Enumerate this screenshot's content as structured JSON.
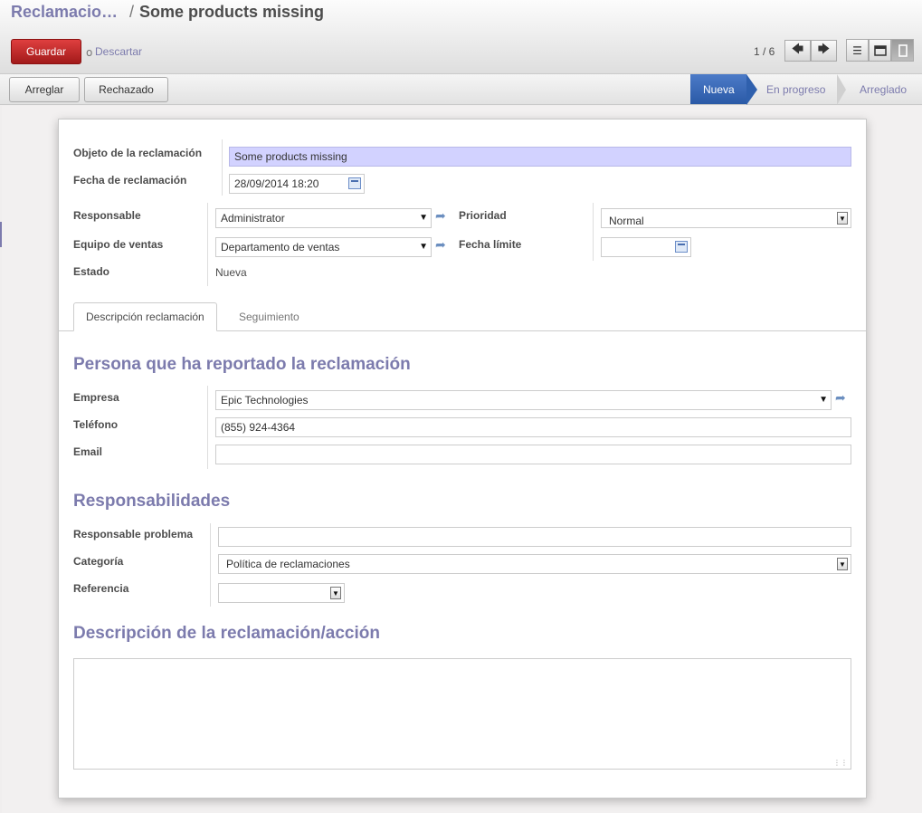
{
  "breadcrumb": {
    "parent": "Reclamacio…",
    "separator": "/",
    "current": "Some products missing"
  },
  "toolbar": {
    "save_label": "Guardar",
    "or_label": "o",
    "discard_label": "Descartar"
  },
  "pager": {
    "text": "1 / 6",
    "prev_icon": "arrow-left-icon",
    "next_icon": "arrow-right-icon"
  },
  "views": [
    {
      "name": "list-view",
      "icon": "list-icon",
      "active": false
    },
    {
      "name": "calendar-view",
      "icon": "calendar-icon",
      "active": false
    },
    {
      "name": "form-view",
      "icon": "form-icon",
      "active": true
    }
  ],
  "status_buttons": {
    "fix": "Arreglar",
    "reject": "Rechazado"
  },
  "stages": [
    "Nueva",
    "En progreso",
    "Arreglado"
  ],
  "form": {
    "subject_label": "Objeto de la reclamación",
    "subject_value": "Some products missing",
    "date_label": "Fecha de reclamación",
    "date_value": "28/09/2014 18:20",
    "responsible_label": "Responsable",
    "responsible_value": "Administrator",
    "team_label": "Equipo de ventas",
    "team_value": "Departamento de ventas",
    "state_label": "Estado",
    "state_value": "Nueva",
    "priority_label": "Prioridad",
    "priority_value": "Normal",
    "deadline_label": "Fecha límite",
    "deadline_value": ""
  },
  "tabs": [
    "Descripción reclamación",
    "Seguimiento"
  ],
  "reporter": {
    "title": "Persona que ha reportado la reclamación",
    "company_label": "Empresa",
    "company_value": "Epic Technologies",
    "phone_label": "Teléfono",
    "phone_value": "(855) 924-4364",
    "email_label": "Email",
    "email_value": ""
  },
  "responsibilities": {
    "title": "Responsabilidades",
    "owner_label": "Responsable problema",
    "owner_value": "",
    "category_label": "Categoría",
    "category_value": "Política de reclamaciones",
    "reference_label": "Referencia",
    "reference_value": ""
  },
  "description": {
    "title": "Descripción de la reclamación/acción",
    "value": ""
  },
  "colors": {
    "accent": "#7c7bad",
    "save": "#c12a2a",
    "stage_active": "#3a6ab7",
    "required_field": "#d2d2ff"
  }
}
